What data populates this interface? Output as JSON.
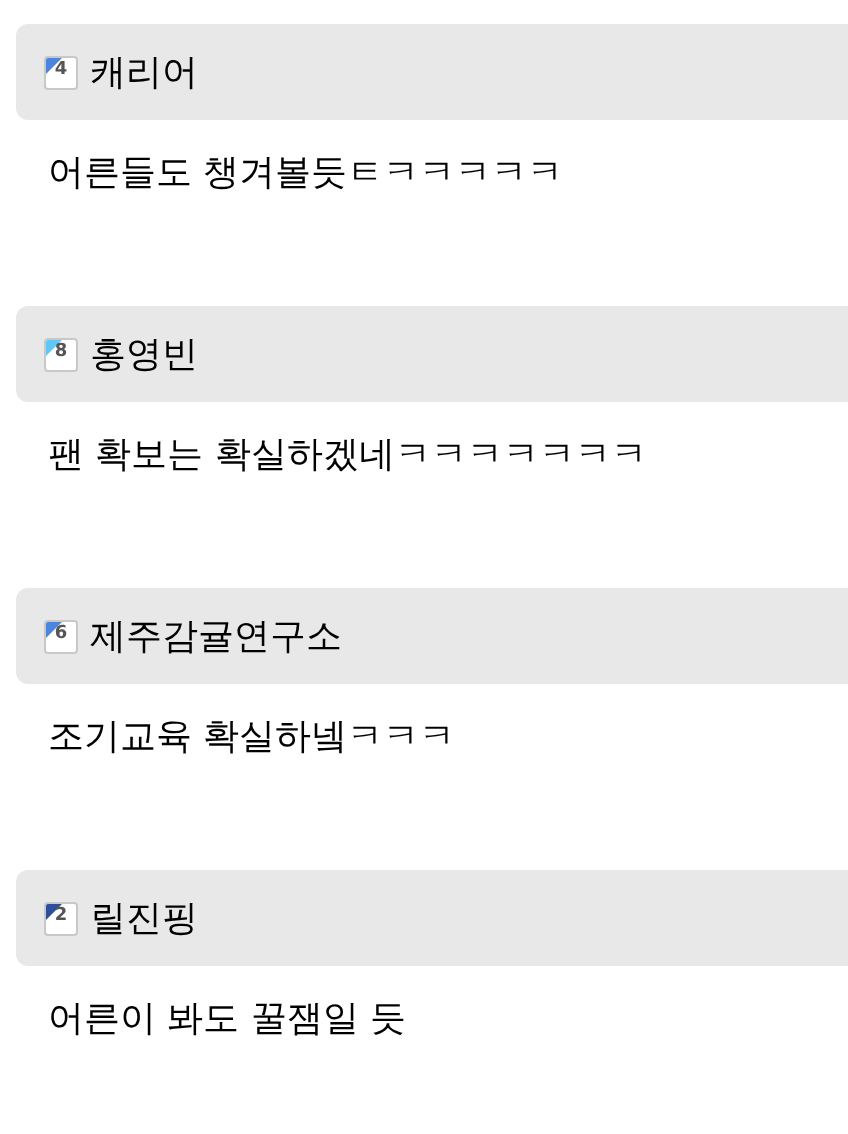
{
  "comments": [
    {
      "level_badge": "4",
      "color": "#4a86e0",
      "author": "캐리어",
      "text": "어른들도 챙겨볼듯ㅌㅋㅋㅋㅋㅋ"
    },
    {
      "level_badge": "8",
      "color": "#5ec8f8",
      "author": "홍영빈",
      "text": "팬 확보는 확실하겠네ㅋㅋㅋㅋㅋㅋㅋ"
    },
    {
      "level_badge": "6",
      "color": "#4a86e0",
      "author": "제주감귤연구소",
      "text": "조기교육 확실하넼ㅋㅋㅋ"
    },
    {
      "level_badge": "2",
      "color": "#2c4f9e",
      "author": "릴진핑",
      "text": "어른이 봐도 꿀잼일 듯"
    }
  ]
}
